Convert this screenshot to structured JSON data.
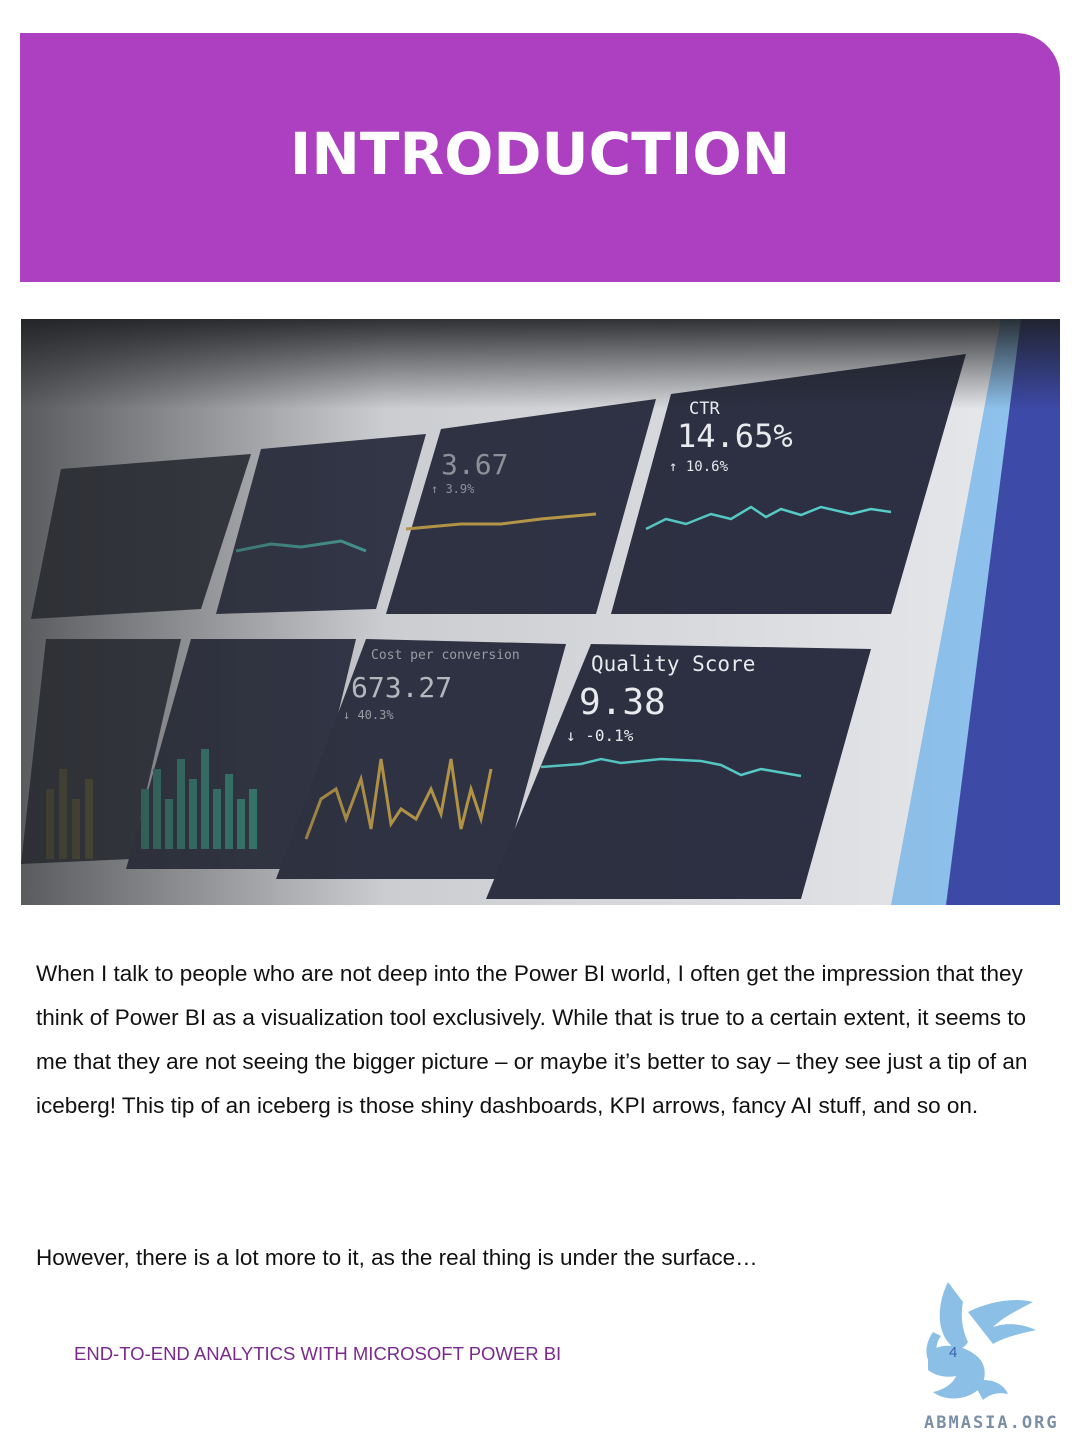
{
  "header": {
    "title": "INTRODUCTION",
    "accent_color": "#ad3fc1"
  },
  "hero_image": {
    "description_icon": "dashboard-photo",
    "tiles": [
      {
        "label": "CTR",
        "value": "14.65%",
        "delta": "↑ 10.6%"
      },
      {
        "label": "Cost per conversion",
        "value": "673.27",
        "delta": "↓ 40.3%"
      },
      {
        "label": "Quality Score",
        "value": "9.38",
        "delta": "↓ -0.1%"
      },
      {
        "label": "",
        "value": "3.67",
        "delta": "↑ 3.9%"
      }
    ]
  },
  "body": {
    "paragraph_1": "When I talk to people who are not deep into the Power BI world, I often get the impression that they think of Power BI as a visualization tool exclusively. While that is true to a certain extent, it seems to me that they are not seeing the bigger picture – or maybe it’s better to say – they see just a tip of an iceberg! This tip of an iceberg is those shiny dashboards, KPI arrows, fancy AI stuff, and so on.",
    "paragraph_2": "However, there is a lot more to it, as the real thing is under the surface…"
  },
  "footer": {
    "book_title": "END-TO-END ANALYTICS WITH MICROSOFT POWER BI",
    "page_number": "4",
    "logo_text": "ABMASIA.ORG",
    "logo_icon": "griffin-logo-icon"
  }
}
